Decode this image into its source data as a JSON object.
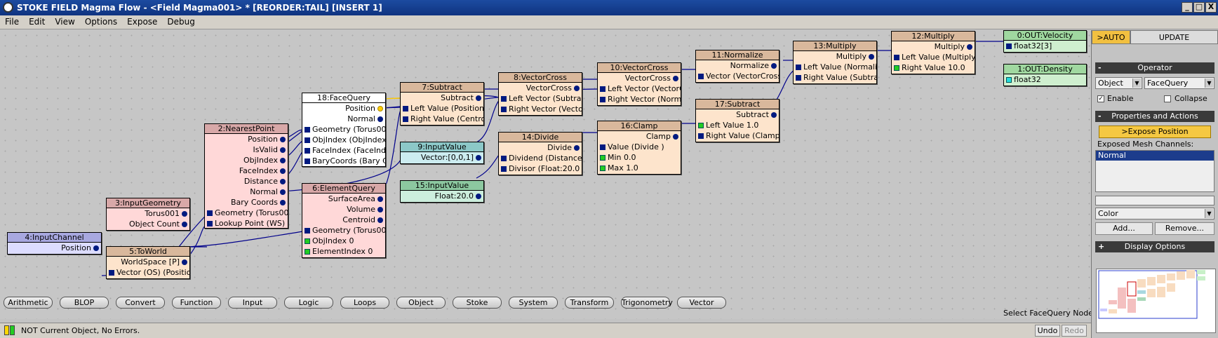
{
  "window": {
    "title": "STOKE FIELD Magma Flow - <Field Magma001> *  [REORDER:TAIL] [INSERT 1]",
    "buttons": [
      "_",
      "□",
      "X"
    ]
  },
  "menu": [
    "File",
    "Edit",
    "View",
    "Options",
    "Expose",
    "Debug"
  ],
  "nodes": {
    "n4": {
      "title": "4:InputChannel",
      "rows": [
        "Position"
      ]
    },
    "n3": {
      "title": "3:InputGeometry",
      "rows": [
        "Torus001",
        "Object Count"
      ]
    },
    "n5": {
      "title": "5:ToWorld",
      "rows": [
        "WorldSpace [P]",
        "Vector (OS) (Position"
      ]
    },
    "n2": {
      "title": "2:NearestPoint",
      "rows": [
        "Position",
        "IsValid",
        "ObjIndex",
        "FaceIndex",
        "Distance",
        "Normal",
        "Bary Coords",
        "Geometry (Torus001",
        "Lookup Point (WS) (V"
      ]
    },
    "n18": {
      "title": "18:FaceQuery",
      "rows": [
        "Position",
        "Normal",
        "Geometry (Torus001",
        "ObjIndex (ObjIndex )",
        "FaceIndex (FaceInde",
        "BaryCoords (Bary Co"
      ]
    },
    "n6": {
      "title": "6:ElementQuery",
      "rows": [
        "SurfaceArea",
        "Volume",
        "Centroid",
        "Geometry (Torus001",
        "ObjIndex 0",
        "ElementIndex 0"
      ]
    },
    "n7": {
      "title": "7:Subtract",
      "rows": [
        "Subtract",
        "Left Value (Position",
        "Right Value (Centroid"
      ]
    },
    "n9": {
      "title": "9:InputValue",
      "rows": [
        "Vector:[0,0,1]"
      ]
    },
    "n15": {
      "title": "15:InputValue",
      "rows": [
        "Float:20.0"
      ]
    },
    "n8": {
      "title": "8:VectorCross",
      "rows": [
        "VectorCross",
        "Left Vector (Subtract",
        "Right Vector (Vector"
      ]
    },
    "n14": {
      "title": "14:Divide",
      "rows": [
        "Divide",
        "Dividend (Distance )",
        "Divisor (Float:20.0 )"
      ]
    },
    "n10": {
      "title": "10:VectorCross",
      "rows": [
        "VectorCross",
        "Left Vector (VectorC",
        "Right Vector (Normal"
      ]
    },
    "n16": {
      "title": "16:Clamp",
      "rows": [
        "Clamp",
        "Value (Divide )",
        "Min 0.0",
        "Max 1.0"
      ]
    },
    "n11": {
      "title": "11:Normalize",
      "rows": [
        "Normalize",
        "Vector (VectorCross"
      ]
    },
    "n17": {
      "title": "17:Subtract",
      "rows": [
        "Subtract",
        "Left Value 1.0",
        "Right Value (Clamp )"
      ]
    },
    "n13": {
      "title": "13:Multiply",
      "rows": [
        "Multiply",
        "Left Value (Normalize",
        "Right Value (Subtract"
      ]
    },
    "n12": {
      "title": "12:Multiply",
      "rows": [
        "Multiply",
        "Left Value (Multiply )",
        "Right Value 10.0"
      ]
    },
    "n0": {
      "title": "0:OUT:Velocity",
      "rows": [
        "float32[3]"
      ]
    },
    "n1": {
      "title": "1:OUT:Density",
      "rows": [
        "float32"
      ]
    }
  },
  "categories": [
    "Arithmetic",
    "BLOP",
    "Convert",
    "Function",
    "Input",
    "Logic",
    "Loops",
    "Object",
    "Stoke",
    "System",
    "Transform",
    "Trigonometry",
    "Vector"
  ],
  "select_hint": "Select FaceQuery Node",
  "status": {
    "message": "NOT Current Object, No Errors.",
    "undo": "Undo",
    "redo": "Redo"
  },
  "panel": {
    "tab_auto": ">AUTO",
    "tab_update": "UPDATE",
    "operator_header": "Operator",
    "operator_minus": "-",
    "object_select": "Object",
    "query_select": "FaceQuery",
    "enable": "Enable",
    "collapse": "Collapse",
    "props_header": "Properties and Actions",
    "props_minus": "-",
    "expose_button": ">Expose Position",
    "exposed_label": "Exposed Mesh Channels:",
    "channels": [
      "Normal"
    ],
    "color_select": "Color",
    "add_button": "Add...",
    "remove_button": "Remove...",
    "display_header": "Display Options",
    "display_plus": "+"
  },
  "colors": {
    "accent_wire": "#00008b",
    "highlight_wire": "#ffcc00",
    "selected_row": "#1c3c8c"
  }
}
